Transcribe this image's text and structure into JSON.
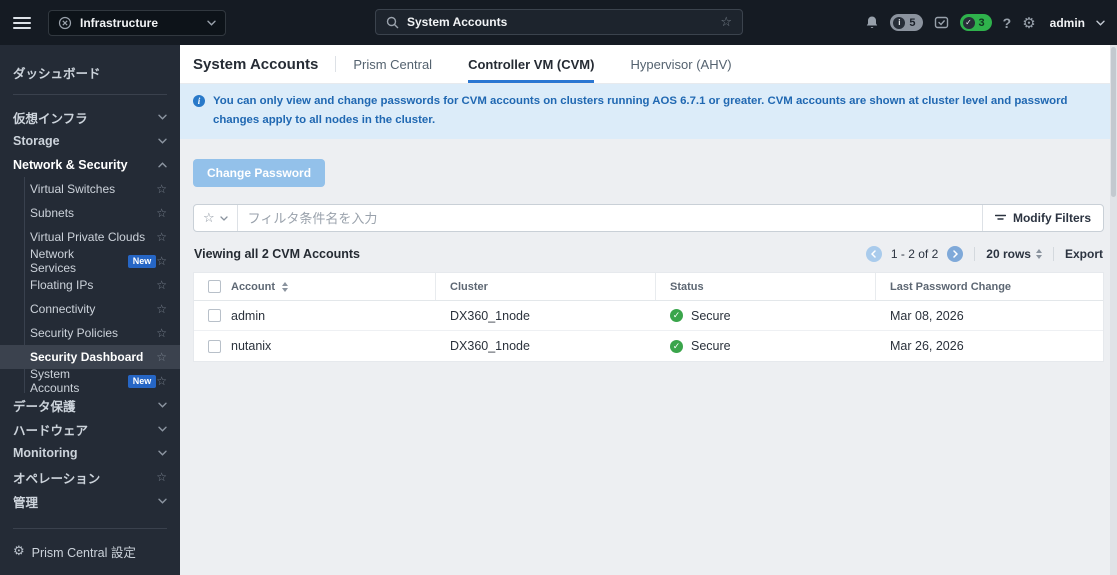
{
  "colors": {
    "accent_blue": "#2b77d2",
    "secure_green": "#3aa54b",
    "banner_bg": "#dcecf9",
    "banner_text": "#2068b2",
    "new_badge_bg": "#2666c5",
    "disabled_button_bg": "#93c1ea",
    "topbar_bg": "#151b23",
    "sidebar_bg": "#242b36"
  },
  "topbar": {
    "menu_label": "Infrastructure",
    "search_value": "System Accounts",
    "notification_count": "5",
    "task_count": "3",
    "help_label": "?",
    "user_name": "admin"
  },
  "sidebar": {
    "items": [
      {
        "id": "dashboard",
        "label": "ダッシュボード",
        "type": "top"
      },
      {
        "type": "divider"
      },
      {
        "id": "virtual-infrastructure",
        "label": "仮想インフラ",
        "type": "section",
        "chevron": "down"
      },
      {
        "id": "storage",
        "label": "Storage",
        "type": "section",
        "chevron": "down"
      },
      {
        "id": "network-security",
        "label": "Network & Security",
        "type": "section",
        "chevron": "up",
        "bold": true
      },
      {
        "id": "virtual-switches",
        "label": "Virtual Switches",
        "type": "sub",
        "star": true
      },
      {
        "id": "subnets",
        "label": "Subnets",
        "type": "sub",
        "star": true
      },
      {
        "id": "virtual-private-clouds",
        "label": "Virtual Private Clouds",
        "type": "sub",
        "star": true
      },
      {
        "id": "network-services",
        "label": "Network Services",
        "type": "sub",
        "star": true,
        "badge": "New"
      },
      {
        "id": "floating-ips",
        "label": "Floating IPs",
        "type": "sub",
        "star": true
      },
      {
        "id": "connectivity",
        "label": "Connectivity",
        "type": "sub",
        "star": true
      },
      {
        "id": "security-policies",
        "label": "Security Policies",
        "type": "sub",
        "star": true
      },
      {
        "id": "security-dashboard",
        "label": "Security Dashboard",
        "type": "sub",
        "star": true,
        "selected": true
      },
      {
        "id": "system-accounts",
        "label": "System Accounts",
        "type": "sub",
        "star": true,
        "badge": "New"
      },
      {
        "id": "data-protection",
        "label": "データ保護",
        "type": "section",
        "chevron": "down"
      },
      {
        "id": "hardware",
        "label": "ハードウェア",
        "type": "section",
        "chevron": "down"
      },
      {
        "id": "monitoring",
        "label": "Monitoring",
        "type": "section",
        "chevron": "down"
      },
      {
        "id": "operations",
        "label": "オペレーション",
        "type": "section",
        "star": true
      },
      {
        "id": "administration",
        "label": "管理",
        "type": "section",
        "chevron": "down"
      }
    ],
    "footer_label": "Prism Central 設定"
  },
  "main": {
    "title": "System Accounts",
    "tabs": [
      {
        "label": "Prism Central",
        "active": false
      },
      {
        "label": "Controller VM (CVM)",
        "active": true
      },
      {
        "label": "Hypervisor (AHV)",
        "active": false
      }
    ],
    "banner_text": "You can only view and change passwords for CVM accounts on clusters running AOS 6.7.1 or greater. CVM accounts are shown at cluster level and password changes apply to all nodes in the cluster.",
    "change_password_label": "Change Password",
    "filter_placeholder": "フィルタ条件名を入力",
    "modify_filters_label": "Modify Filters",
    "viewing_label": "Viewing all 2 CVM Accounts",
    "pagination_label": "1 - 2 of 2",
    "rows_per_page": "20 rows",
    "export_label": "Export",
    "table": {
      "headers": [
        "Account",
        "Cluster",
        "Status",
        "Last Password Change"
      ],
      "rows": [
        {
          "account": "admin",
          "cluster": "DX360_1node",
          "status": "Secure",
          "last_password_change": "Mar 08, 2026"
        },
        {
          "account": "nutanix",
          "cluster": "DX360_1node",
          "status": "Secure",
          "last_password_change": "Mar 26, 2026"
        }
      ]
    }
  }
}
